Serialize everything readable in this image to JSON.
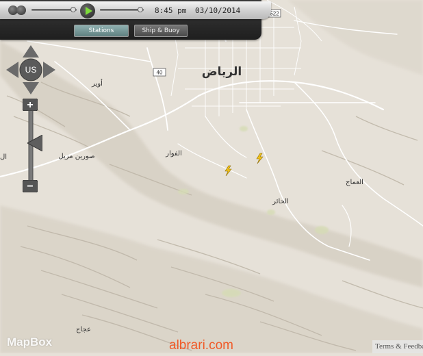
{
  "player": {
    "time": "8:45 pm",
    "date": "03/10/2014"
  },
  "tabs": [
    {
      "label": "Stations",
      "active": true
    },
    {
      "label": "Ship & Buoy",
      "active": false
    }
  ],
  "pan_control": {
    "label": "US"
  },
  "zoom_control": {
    "zoom_in": "+",
    "zoom_out": "−"
  },
  "map": {
    "places": {
      "riyadh": "الرياض",
      "owaina": "أوير",
      "fawwar": "الفوار",
      "soura": "صورين مزيل",
      "hair": "الحائر",
      "ammaj": "العماج",
      "ajaj": "عجاج",
      "edge": "ال"
    },
    "shields": {
      "r40": "40",
      "r522": "522"
    },
    "lightning_icon_count": 2,
    "colors": {
      "land": "#e6e1d8",
      "road": "#ffffff",
      "relief": "#c9c2b6"
    }
  },
  "attribution": {
    "logo": "MapBox",
    "terms": "Terms & Feedback"
  },
  "watermark": "albrari.com"
}
